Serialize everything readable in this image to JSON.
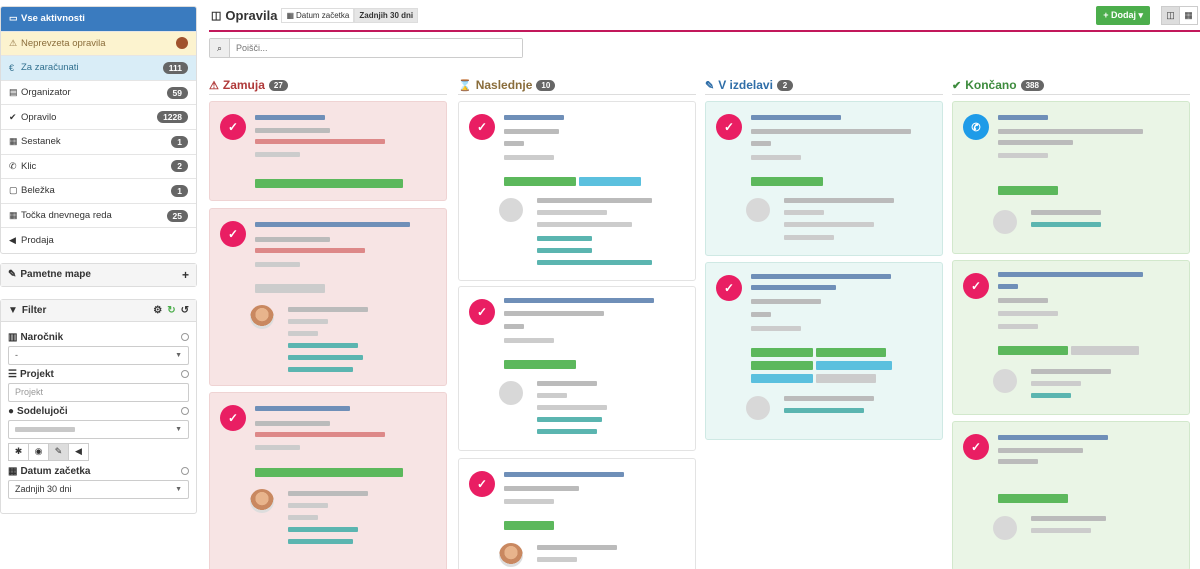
{
  "sidebar": {
    "nav": [
      {
        "label": "Vse aktivnosti",
        "icon": "inbox-icon",
        "state": "active"
      },
      {
        "label": "Neprevzeta opravila",
        "icon": "warning-icon",
        "state": "warn"
      },
      {
        "label": "Za zaračunati",
        "icon": "euro-icon",
        "state": "info",
        "count": "111"
      },
      {
        "label": "Organizator",
        "icon": "book-icon",
        "count": "59"
      },
      {
        "label": "Opravilo",
        "icon": "check-icon",
        "count": "1228"
      },
      {
        "label": "Sestanek",
        "icon": "calendar-icon",
        "count": "1"
      },
      {
        "label": "Klic",
        "icon": "phone-icon",
        "count": "2"
      },
      {
        "label": "Beležka",
        "icon": "note-icon",
        "count": "1"
      },
      {
        "label": "Točka dnevnega reda",
        "icon": "calendar-icon",
        "count": "25"
      },
      {
        "label": "Prodaja",
        "icon": "megaphone-icon"
      }
    ],
    "smart_maps": {
      "title": "Pametne mape",
      "add": "+"
    },
    "filter": {
      "title": "Filter",
      "client": {
        "label": "Naročnik",
        "value": "-"
      },
      "project": {
        "label": "Projekt",
        "placeholder": "Projekt"
      },
      "participants": {
        "label": "Sodelujoči"
      },
      "start_date": {
        "label": "Datum začetka",
        "value": "Zadnjih 30 dni"
      }
    }
  },
  "header": {
    "title": "Opravila",
    "filter_label": "Datum začetka",
    "filter_value": "Zadnjih 30 dni",
    "add_label": "+ Dodaj ▾"
  },
  "search": {
    "placeholder": "Poišči..."
  },
  "columns": [
    {
      "title": "Zamuja",
      "count": "27",
      "color": "#b03a3a",
      "icon": "warning-icon"
    },
    {
      "title": "Naslednje",
      "count": "10",
      "color": "#8a6d3b",
      "icon": "hourglass-icon"
    },
    {
      "title": "V izdelavi",
      "count": "2",
      "color": "#2f6ea8",
      "icon": "wrench-icon"
    },
    {
      "title": "Končano",
      "count": "388",
      "color": "#3d8b3d",
      "icon": "check-icon"
    }
  ],
  "colors": {
    "accent": "#c2185b",
    "task_badge": "#e91e63",
    "call_badge": "#1e9be8",
    "active_nav": "#3a7bbf",
    "add_button": "#4cae4c"
  }
}
